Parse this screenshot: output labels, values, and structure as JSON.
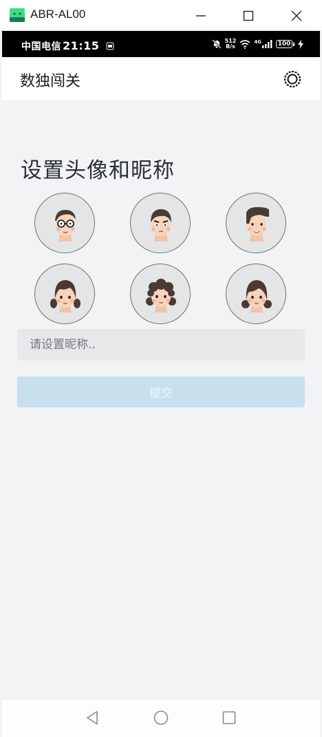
{
  "window": {
    "title": "ABR-AL00",
    "logo_icon": "android-icon",
    "minimize_icon": "minimize-icon",
    "maximize_icon": "maximize-icon",
    "close_icon": "close-icon"
  },
  "statusbar": {
    "carrier": "中国电信",
    "time": "21:15",
    "net_speed_value": "512",
    "net_speed_unit": "B/s",
    "network_type": "4G",
    "battery": "100"
  },
  "appbar": {
    "title": "数独闯关",
    "settings_icon": "settings-icon"
  },
  "main": {
    "heading": "设置头像和昵称",
    "avatars": [
      {
        "name": "avatar-boy-glasses",
        "gender": "male"
      },
      {
        "name": "avatar-boy-angry",
        "gender": "male"
      },
      {
        "name": "avatar-boy-pompadour",
        "gender": "male"
      },
      {
        "name": "avatar-girl-braids",
        "gender": "female"
      },
      {
        "name": "avatar-girl-curly",
        "gender": "female"
      },
      {
        "name": "avatar-girl-pigtails",
        "gender": "female"
      }
    ],
    "nickname_input": {
      "value": "",
      "placeholder": "请设置昵称.."
    },
    "submit_label": "提交",
    "submit_enabled": false
  },
  "colors": {
    "page_background": "#f2f3f5",
    "submit_disabled": "#c8e0ee",
    "input_background": "#e7e8ea",
    "avatar_background": "#e4e5e7"
  },
  "navbar": {
    "back_icon": "triangle-back-icon",
    "home_icon": "circle-home-icon",
    "recents_icon": "square-recents-icon"
  }
}
